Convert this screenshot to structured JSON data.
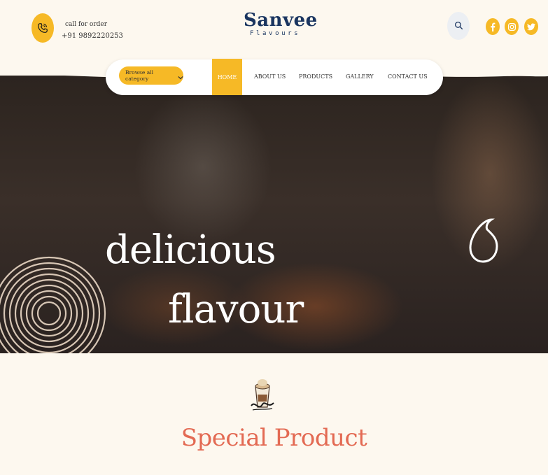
{
  "contact": {
    "call_label": "call for order",
    "phone": "+91 9892220253"
  },
  "brand": {
    "name": "Sanvee",
    "tagline": "Flavours"
  },
  "header_icons": [
    "phone-icon",
    "search-icon",
    "facebook-icon",
    "instagram-icon",
    "twitter-icon"
  ],
  "nav": {
    "category_button": "Browse all category",
    "items": [
      {
        "label": "HOME",
        "active": true
      },
      {
        "label": "ABOUT US",
        "active": false
      },
      {
        "label": "PRODUCTS",
        "active": false
      },
      {
        "label": "GALLERY",
        "active": false
      },
      {
        "label": "CONTACT US",
        "active": false
      }
    ]
  },
  "hero": {
    "line1": "delicious",
    "line2": "flavour"
  },
  "section": {
    "title": "Special Product",
    "icon": "coffee-cup-icon"
  },
  "colors": {
    "accent": "#f6b926",
    "brand": "#1a3560",
    "title": "#e36a53",
    "background": "#fdf8ef"
  }
}
